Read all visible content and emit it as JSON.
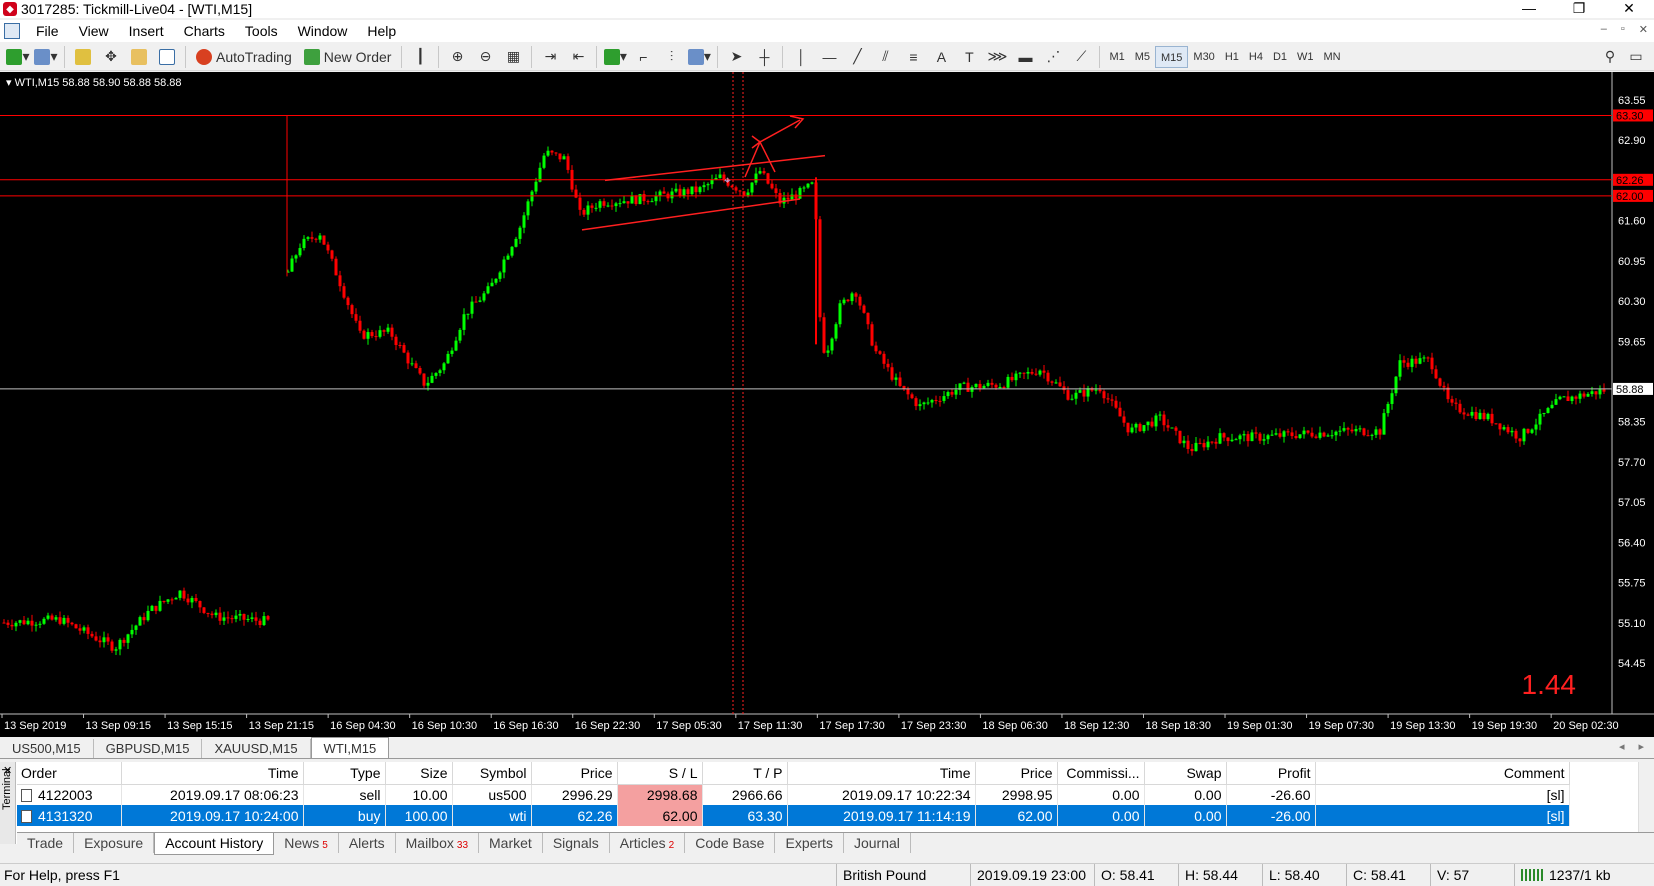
{
  "window": {
    "title": "3017285: Tickmill-Live04 - [WTI,M15]"
  },
  "menu": [
    "File",
    "View",
    "Insert",
    "Charts",
    "Tools",
    "Window",
    "Help"
  ],
  "toolbar": {
    "autotrading_label": "AutoTrading",
    "new_order_label": "New Order",
    "timeframes": [
      "M1",
      "M5",
      "M15",
      "M30",
      "H1",
      "H4",
      "D1",
      "W1",
      "MN"
    ],
    "active_timeframe": "M15"
  },
  "chart": {
    "header": "WTI,M15  58.88 58.90 58.88 58.88",
    "spread": "1.44",
    "price_labels": [
      "63.55",
      "62.90",
      "61.60",
      "60.95",
      "60.30",
      "59.65",
      "58.35",
      "57.70",
      "57.05",
      "56.40",
      "55.75",
      "55.10",
      "54.45"
    ],
    "marker_labels": [
      {
        "text": "63.30",
        "color": "#ff0000"
      },
      {
        "text": "62.26",
        "color": "#ff0000"
      },
      {
        "text": "62.00",
        "color": "#ff0000"
      },
      {
        "text": "58.88",
        "color": "#ffffff"
      }
    ],
    "time_labels": [
      "13 Sep 2019",
      "13 Sep 09:15",
      "13 Sep 15:15",
      "13 Sep 21:15",
      "16 Sep 04:30",
      "16 Sep 10:30",
      "16 Sep 16:30",
      "16 Sep 22:30",
      "17 Sep 05:30",
      "17 Sep 11:30",
      "17 Sep 17:30",
      "17 Sep 23:30",
      "18 Sep 06:30",
      "18 Sep 12:30",
      "18 Sep 18:30",
      "19 Sep 01:30",
      "19 Sep 07:30",
      "19 Sep 13:30",
      "19 Sep 19:30",
      "20 Sep 02:30"
    ],
    "colors": {
      "bull": "#00ff00",
      "bear": "#ff0000",
      "grid_line": "#ff0000",
      "bid_line": "#c0c0c0"
    }
  },
  "symbol_tabs": [
    "US500,M15",
    "GBPUSD,M15",
    "XAUUSD,M15",
    "WTI,M15"
  ],
  "active_symbol_tab": "WTI,M15",
  "terminal": {
    "side_label": "Terminal",
    "columns": [
      "Order",
      "Time",
      "Type",
      "Size",
      "Symbol",
      "Price",
      "S / L",
      "T / P",
      "Time",
      "Price",
      "Commissi...",
      "Swap",
      "Profit",
      "Comment"
    ],
    "rows": [
      {
        "order": "4122003",
        "time": "2019.09.17 08:06:23",
        "type": "sell",
        "size": "10.00",
        "symbol": "us500",
        "price": "2996.29",
        "sl": "2998.68",
        "tp": "2966.66",
        "close_time": "2019.09.17 10:22:34",
        "close_price": "2998.95",
        "commission": "0.00",
        "swap": "0.00",
        "profit": "-26.60",
        "comment": "[sl]"
      },
      {
        "order": "4131320",
        "time": "2019.09.17 10:24:00",
        "type": "buy",
        "size": "100.00",
        "symbol": "wti",
        "price": "62.26",
        "sl": "62.00",
        "tp": "63.30",
        "close_time": "2019.09.17 11:14:19",
        "close_price": "62.00",
        "commission": "0.00",
        "swap": "0.00",
        "profit": "-26.00",
        "comment": "[sl]"
      }
    ],
    "tabs": [
      {
        "label": "Trade",
        "badge": ""
      },
      {
        "label": "Exposure",
        "badge": ""
      },
      {
        "label": "Account History",
        "badge": ""
      },
      {
        "label": "News",
        "badge": "5"
      },
      {
        "label": "Alerts",
        "badge": ""
      },
      {
        "label": "Mailbox",
        "badge": "33"
      },
      {
        "label": "Market",
        "badge": ""
      },
      {
        "label": "Signals",
        "badge": ""
      },
      {
        "label": "Articles",
        "badge": "2"
      },
      {
        "label": "Code Base",
        "badge": ""
      },
      {
        "label": "Experts",
        "badge": ""
      },
      {
        "label": "Journal",
        "badge": ""
      }
    ],
    "active_tab": "Account History"
  },
  "status": {
    "help": "For Help, press F1",
    "profile": "British Pound",
    "datetime": "2019.09.19 23:00",
    "open": "O: 58.41",
    "high": "H: 58.44",
    "low": "L: 58.40",
    "close": "C: 58.41",
    "volume": "V: 57",
    "traffic": "1237/1 kb"
  }
}
